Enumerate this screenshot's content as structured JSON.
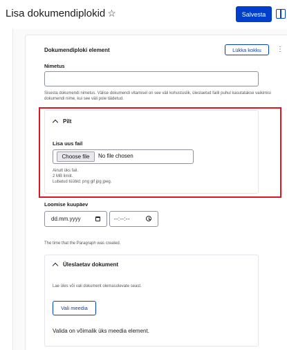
{
  "header": {
    "title": "Lisa dokumendiplokid",
    "star_icon": "star-outline-icon",
    "save_label": "Salvesta",
    "sidebar_toggle_icon": "sidebar-toggle-icon"
  },
  "paragraph": {
    "title": "Dokumendiploki element",
    "collapse_label": "Lükka kokku",
    "kebab": "⋮",
    "name_label": "Nimetus",
    "name_value": "",
    "name_help": "Sisesta dokumendi nimetus. Välise dokumendi vitamisel on see väli kohustuslik, üleslaetud failil puhul kasutatakse vaikimisi dokumendi nime, kui see väli pole täidetud."
  },
  "pilt": {
    "summary": "Pilt",
    "upload_label": "Lisa uus fail",
    "choose_button": "Choose file",
    "no_file_text": "No file chosen",
    "help_lines": [
      "Ainult üks fail.",
      "2 MB limiit.",
      "Lubatud tüübid: png gif jpg jpeg."
    ]
  },
  "created": {
    "label": "Loomise kuupäev",
    "date_placeholder": "dd.mm.yyyy",
    "time_placeholder": "--:--:--",
    "help": "The time that the Paragraph was created."
  },
  "document": {
    "summary": "Üleslaetav dokument",
    "help": "Lae üles või vali dokument olemasolevate seast.",
    "media_button": "Vali meedia",
    "limit_text": "Valida on võimalik üks meedia element."
  },
  "colors": {
    "accent": "#003ecc",
    "highlight": "#e0141e"
  }
}
